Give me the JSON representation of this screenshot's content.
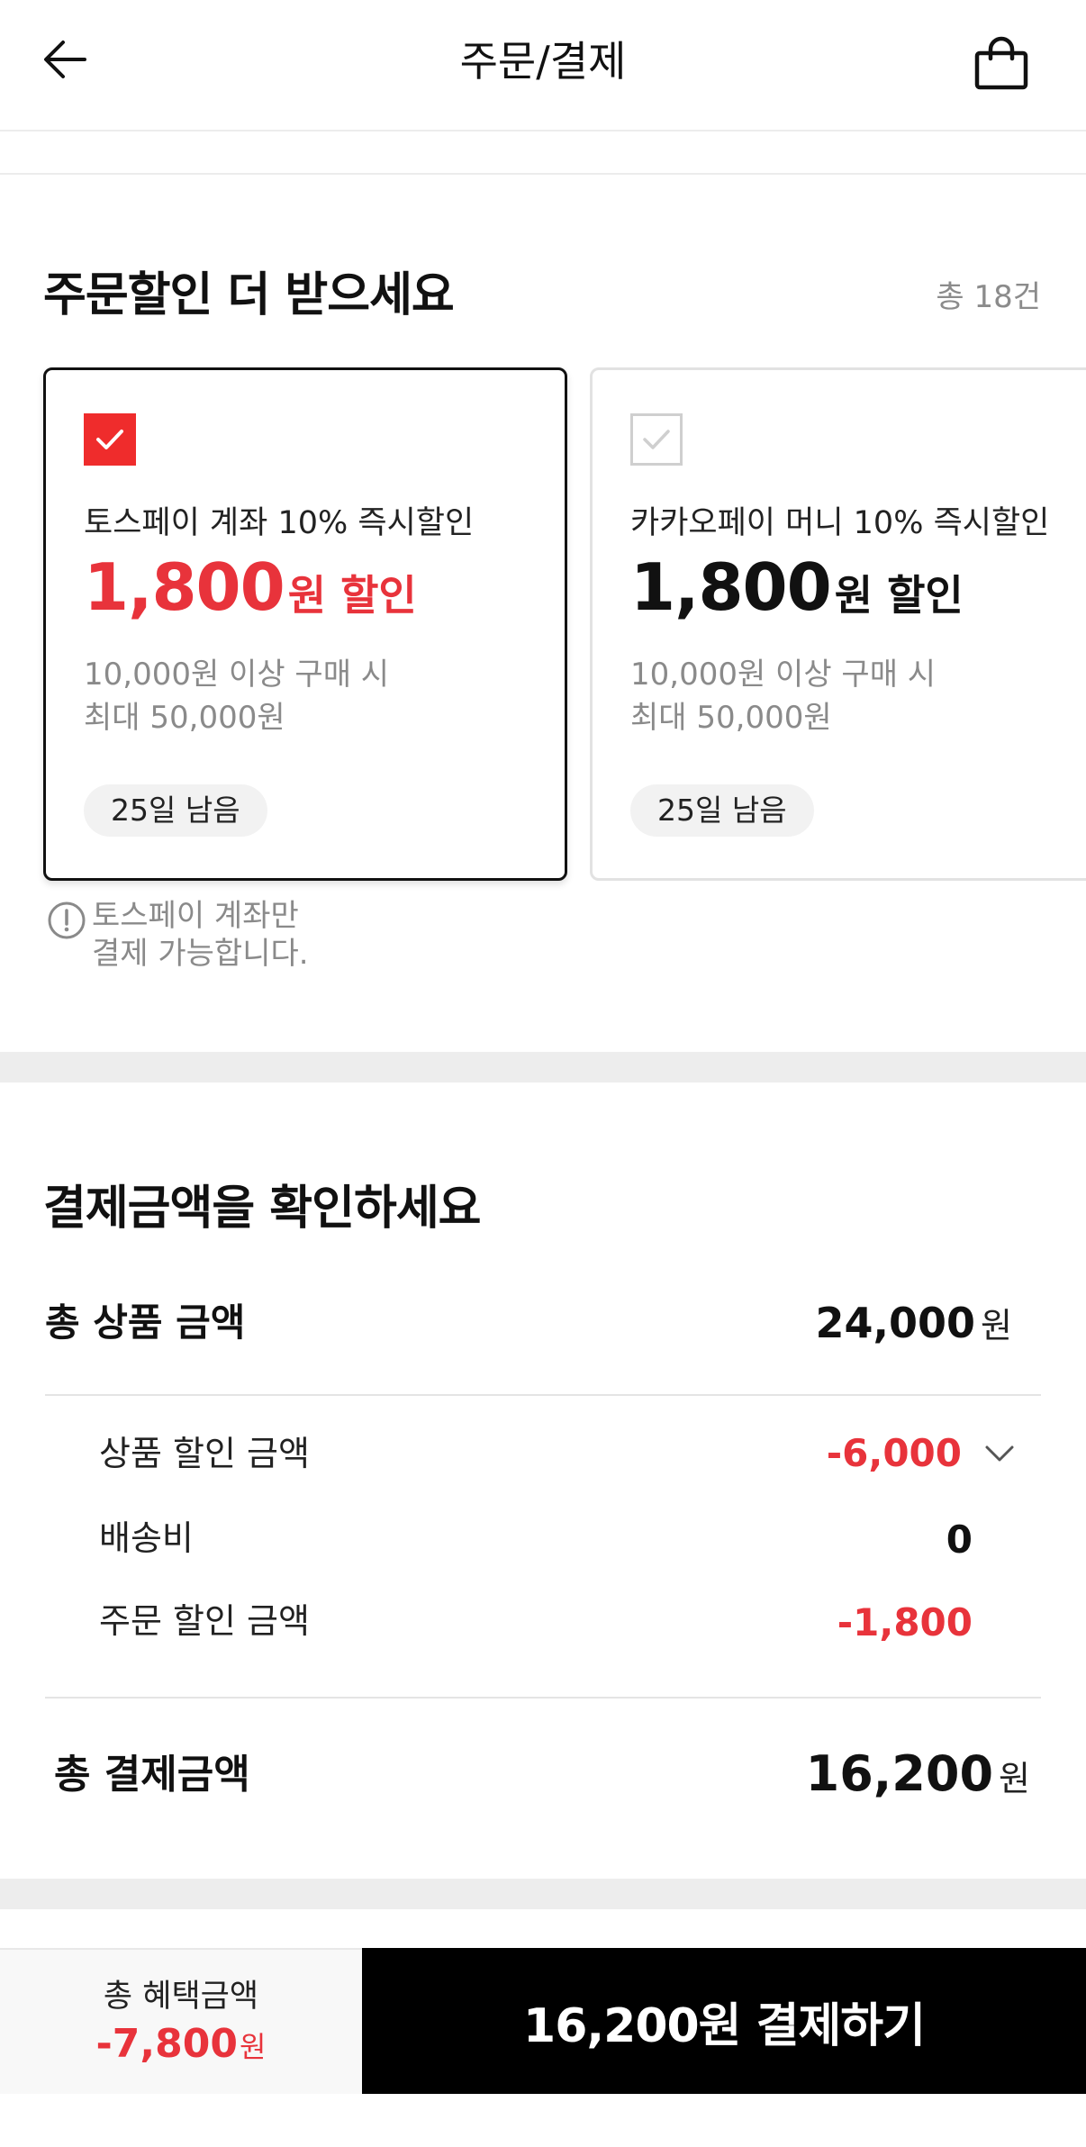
{
  "header": {
    "title": "주문/결제",
    "back_icon": "arrow-left-icon",
    "bag_icon": "shopping-bag-icon"
  },
  "discounts": {
    "title": "주문할인 더 받으세요",
    "count": "총 18건",
    "cards": [
      {
        "selected": true,
        "name": "토스페이 계좌 10% 즉시할인",
        "amount": "1,800",
        "amount_unit": "원 할인",
        "condition_line1": "10,000원 이상 구매 시",
        "condition_line2": "최대 50,000원",
        "badge": "25일 남음"
      },
      {
        "selected": false,
        "name": "카카오페이 머니 10% 즉시할인",
        "amount": "1,800",
        "amount_unit": "원 할인",
        "condition_line1": "10,000원 이상 구매 시",
        "condition_line2": "최대 50,000원",
        "badge": "25일 남음"
      }
    ],
    "notice_line1": "토스페이 계좌만",
    "notice_line2": "결제 가능합니다."
  },
  "payment": {
    "title": "결제금액을 확인하세요",
    "total_product_label": "총 상품 금액",
    "total_product_value": "24,000",
    "currency": "원",
    "product_discount_label": "상품 할인 금액",
    "product_discount_value": "-6,000",
    "shipping_label": "배송비",
    "shipping_value": "0",
    "order_discount_label": "주문 할인 금액",
    "order_discount_value": "-1,800",
    "total_payment_label": "총 결제금액",
    "total_payment_value": "16,200"
  },
  "bottom": {
    "benefit_label": "총 혜택금액",
    "benefit_value": "-7,800",
    "benefit_unit": "원",
    "pay_button": "16,200원 결제하기"
  },
  "colors": {
    "accent_red": "#e8333b",
    "checkbox_red": "#ef2c2c",
    "button_black": "#000000"
  }
}
